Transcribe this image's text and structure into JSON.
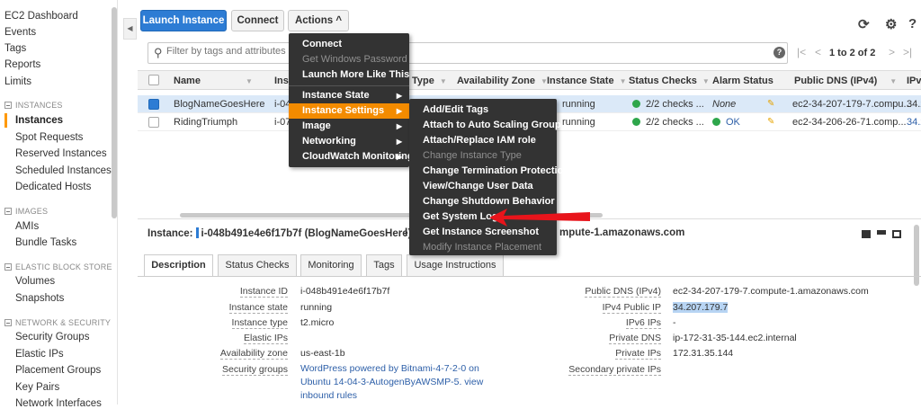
{
  "sidebar": {
    "top_items": [
      "EC2 Dashboard",
      "Events",
      "Tags",
      "Reports",
      "Limits"
    ],
    "sections": [
      {
        "title": "INSTANCES",
        "items": [
          "Instances",
          "Spot Requests",
          "Reserved Instances",
          "Scheduled Instances",
          "Dedicated Hosts"
        ]
      },
      {
        "title": "IMAGES",
        "items": [
          "AMIs",
          "Bundle Tasks"
        ]
      },
      {
        "title": "ELASTIC BLOCK STORE",
        "items": [
          "Volumes",
          "Snapshots"
        ]
      },
      {
        "title": "NETWORK & SECURITY",
        "items": [
          "Security Groups",
          "Elastic IPs",
          "Placement Groups",
          "Key Pairs",
          "Network Interfaces"
        ]
      }
    ],
    "active_item": "Instances"
  },
  "toolbar": {
    "launch_label": "Launch Instance",
    "connect_label": "Connect",
    "actions_label": "Actions ^",
    "refresh_icon": "refresh-icon",
    "settings_icon": "gear-icon",
    "help_icon": "help-icon",
    "accent": "#2d7cd4"
  },
  "filter": {
    "placeholder": "Filter by tags and attributes or search by keyword",
    "visible_text": "Filter by tags and attributes or s"
  },
  "pagination": {
    "text": "1 to 2 of 2",
    "first": "|<",
    "prev": "<",
    "next": ">",
    "last": ">|"
  },
  "table": {
    "columns": [
      "Name",
      "Instance ID",
      "Instance Type",
      "Availability Zone",
      "Instance State",
      "Status Checks",
      "Alarm Status",
      "Public DNS (IPv4)",
      "IPv4"
    ],
    "column_visible": {
      "name": "Name",
      "id": "Ins",
      "type": "Type",
      "zone": "Availability Zone",
      "state": "Instance State",
      "checks": "Status Checks",
      "alarm": "Alarm Status",
      "dns": "Public DNS (IPv4)",
      "ipv4": "IPv"
    },
    "rows": [
      {
        "name": "BlogNameGoesHere",
        "id": "i-04",
        "state": "running",
        "checks": "2/2 checks ...",
        "alarm": "None",
        "dns": "ec2-34-207-179-7.compu...",
        "ip": "34.2",
        "selected": true
      },
      {
        "name": "RidingTriumph",
        "id": "i-07",
        "state": "running",
        "checks": "2/2 checks ...",
        "alarm": "OK",
        "dns": "ec2-34-206-26-71.comp...",
        "ip": "34.2",
        "selected": false
      }
    ]
  },
  "actions_menu": {
    "items": [
      {
        "label": "Connect",
        "disabled": false
      },
      {
        "label": "Get Windows Password",
        "disabled": true
      },
      {
        "label": "Launch More Like This",
        "disabled": false
      },
      {
        "label": "Instance State",
        "submenu": true
      },
      {
        "label": "Instance Settings",
        "submenu": true,
        "highlighted": true
      },
      {
        "label": "Image",
        "submenu": true
      },
      {
        "label": "Networking",
        "submenu": true
      },
      {
        "label": "CloudWatch Monitoring",
        "submenu": true
      }
    ]
  },
  "settings_menu": {
    "items": [
      {
        "label": "Add/Edit Tags",
        "disabled": false
      },
      {
        "label": "Attach to Auto Scaling Group",
        "disabled": false
      },
      {
        "label": "Attach/Replace IAM role",
        "disabled": false
      },
      {
        "label": "Change Instance Type",
        "disabled": true
      },
      {
        "label": "Change Termination Protection",
        "disabled": false
      },
      {
        "label": "View/Change User Data",
        "disabled": false
      },
      {
        "label": "Change Shutdown Behavior",
        "disabled": false
      },
      {
        "label": "Get System Log",
        "disabled": false
      },
      {
        "label": "Get Instance Screenshot",
        "disabled": false
      },
      {
        "label": "Modify Instance Placement",
        "disabled": true
      }
    ],
    "highlight_color": "#f38b00"
  },
  "detail": {
    "instance_label": "Instance:",
    "instance_value": "i-048b491e4e6f17b7f (BlogNameGoesHere)",
    "dns_label_visible": "I",
    "dns_value_visible": "mpute-1.amazonaws.com",
    "tabs": [
      "Description",
      "Status Checks",
      "Monitoring",
      "Tags",
      "Usage Instructions"
    ],
    "left_fields": [
      {
        "label": "Instance ID",
        "value": "i-048b491e4e6f17b7f"
      },
      {
        "label": "Instance state",
        "value": "running"
      },
      {
        "label": "Instance type",
        "value": "t2.micro"
      },
      {
        "label": "Elastic IPs",
        "value": ""
      },
      {
        "label": "Availability zone",
        "value": "us-east-1b"
      },
      {
        "label": "Security groups",
        "value": "WordPress powered by Bitnami-4-7-2-0 on Ubuntu 14-04-3-AutogenByAWSMP-5. view inbound rules"
      }
    ],
    "right_fields": [
      {
        "label": "Public DNS (IPv4)",
        "value": "ec2-34-207-179-7.compute-1.amazonaws.com"
      },
      {
        "label": "IPv4 Public IP",
        "value": "34.207.179.7"
      },
      {
        "label": "IPv6 IPs",
        "value": "-"
      },
      {
        "label": "Private DNS",
        "value": "ip-172-31-35-144.ec2.internal"
      },
      {
        "label": "Private IPs",
        "value": "172.31.35.144"
      },
      {
        "label": "Secondary private IPs",
        "value": ""
      }
    ]
  },
  "annotation": {
    "arrow_color": "#e8141b"
  }
}
